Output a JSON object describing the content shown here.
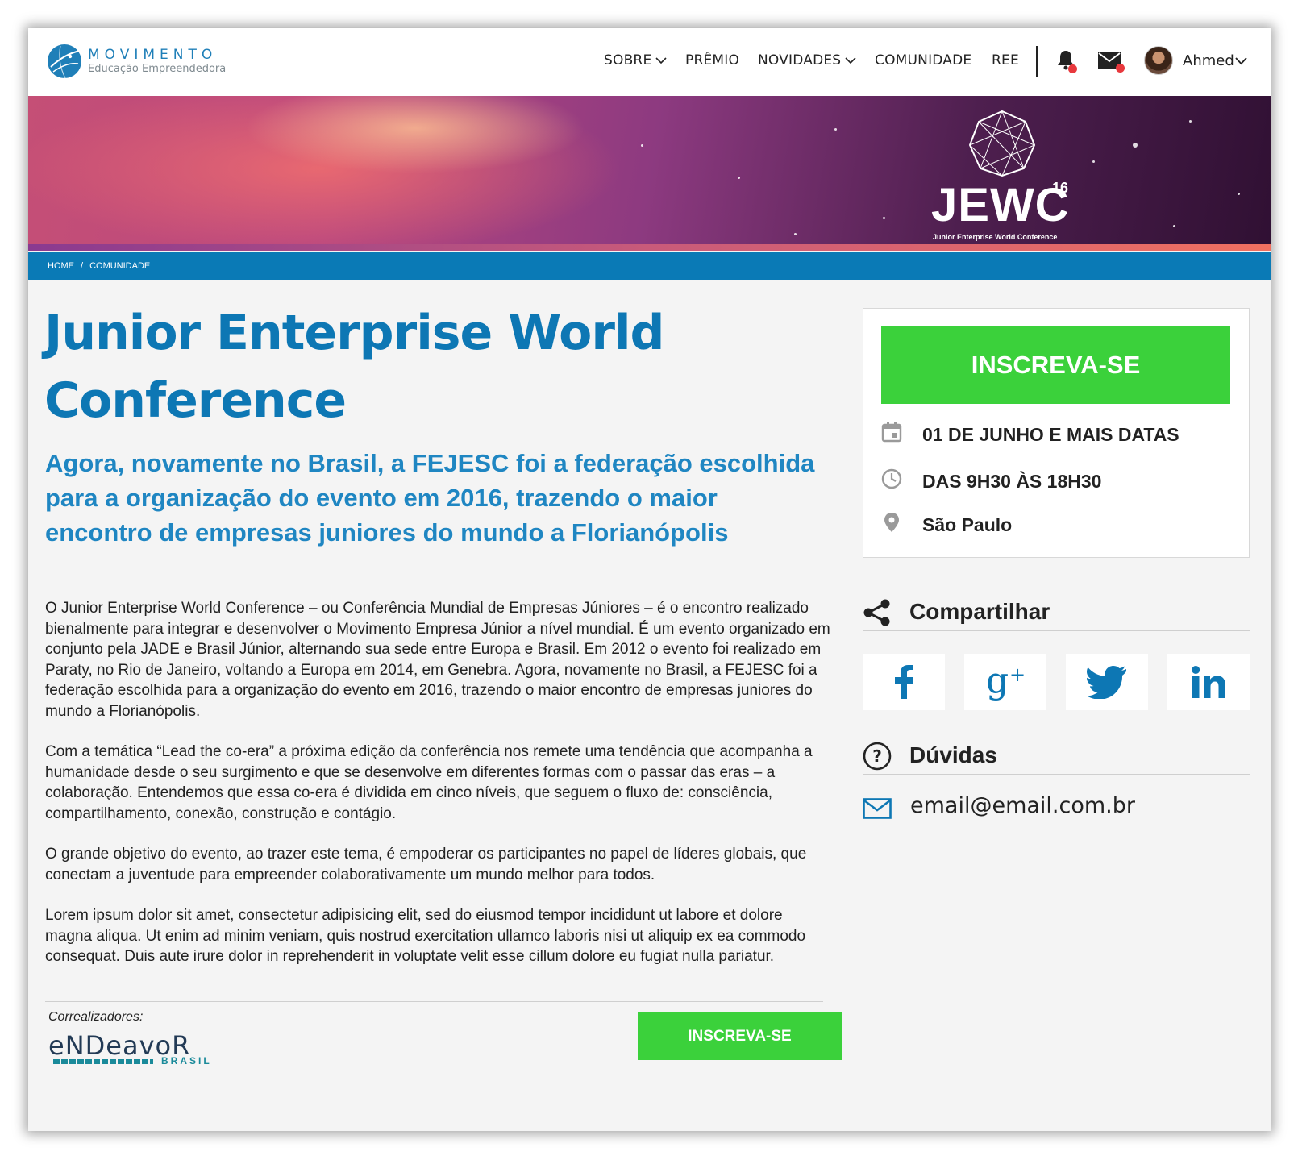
{
  "brand": {
    "title": "MOVIMENTO",
    "subtitle": "Educação Empreendedora",
    "accent": "#0d77b4"
  },
  "nav": {
    "items": [
      {
        "label": "SOBRE",
        "has_dropdown": true
      },
      {
        "label": "PRÊMIO",
        "has_dropdown": false
      },
      {
        "label": "NOVIDADES",
        "has_dropdown": true
      },
      {
        "label": "COMUNIDADE",
        "has_dropdown": false
      },
      {
        "label": "REE",
        "has_dropdown": false
      }
    ],
    "user_name": "Ahmed",
    "notification_icon": "bell-icon",
    "message_icon": "mail-icon"
  },
  "banner": {
    "event_logo": "JEWC",
    "event_logo_sup": "16",
    "event_logo_sub": "Junior Enterprise World Conference"
  },
  "breadcrumb": [
    "HOME",
    "/",
    "COMUNIDADE"
  ],
  "main": {
    "title": "Junior Enterprise World Conference",
    "subtitle": "Agora, novamente no Brasil, a FEJESC foi a federação escolhida para a organização do evento em 2016, trazendo o maior encontro de empresas juniores do mundo a Florianópolis",
    "paragraphs": [
      "O Junior Enterprise World Conference – ou Conferência Mundial de Empresas Júniores – é o encontro realizado bienalmente para integrar e desenvolver o Movimento Empresa Júnior a nível mundial. É um evento organizado em conjunto pela JADE e Brasil Júnior, alternando sua sede entre Europa e Brasil. Em 2012 o evento foi realizado em Paraty, no Rio de Janeiro, voltando a Europa em 2014, em Genebra. Agora, novamente no Brasil, a FEJESC foi a federação escolhida para a organização do evento em 2016, trazendo o maior encontro de empresas juniores do mundo a Florianópolis.",
      "Com a temática “Lead the co-era” a próxima edição da conferência nos remete uma tendência que acompanha a humanidade desde o seu surgimento e que se desenvolve em diferentes formas com o passar das eras – a colaboração. Entendemos que essa co-era é dividida em cinco níveis, que seguem o fluxo de: consciência, compartilhamento, conexão, construção e contágio.",
      "O grande objetivo do evento, ao trazer este tema, é empoderar os participantes no papel de líderes globais, que conectam a juventude para empreender colaborativamente um mundo melhor para todos.",
      "Lorem ipsum dolor sit amet, consectetur adipisicing elit, sed do eiusmod tempor incididunt ut labore et dolore magna aliqua. Ut enim ad minim veniam, quis nostrud exercitation ullamco laboris nisi ut aliquip ex ea commodo consequat. Duis aute irure dolor in reprehenderit in voluptate velit esse cillum dolore eu fugiat nulla pariatur."
    ],
    "correalizadores_label": "Correalizadores:",
    "sponsor_word": "eNDeavoR",
    "sponsor_country": "BRASIL",
    "cta_label": "INSCREVA-SE",
    "cta_color": "#3bd13b"
  },
  "sidebar": {
    "cta_label": "INSCREVA-SE",
    "date": "01 DE JUNHO E MAIS DATAS",
    "time": "DAS 9H30 ÀS 18H30",
    "location": "São Paulo",
    "share_title": "Compartilhar",
    "share_icons": [
      "facebook-icon",
      "google-plus-icon",
      "twitter-icon",
      "linkedin-icon"
    ],
    "questions_title": "Dúvidas",
    "email": "email@email.com.br"
  }
}
